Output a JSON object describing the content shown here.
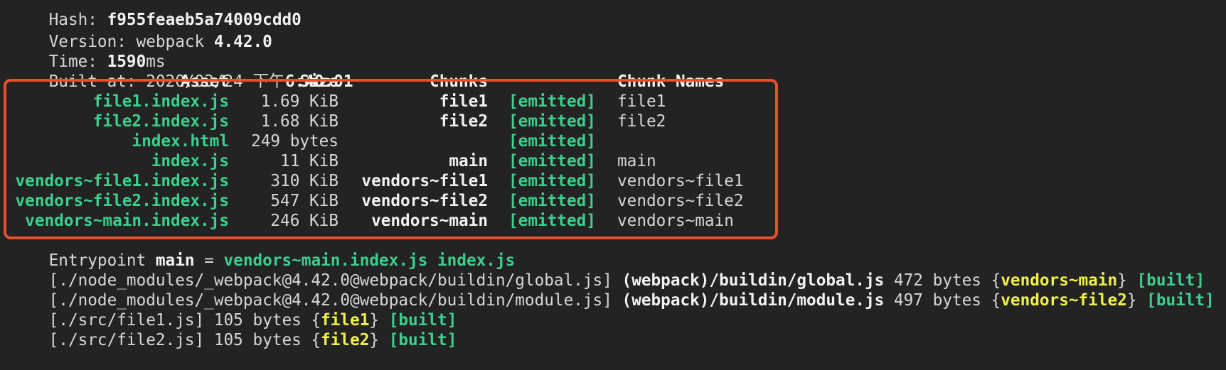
{
  "header": {
    "hash_label": "Hash: ",
    "hash_value": "f955feaeb5a74009cdd0",
    "version_label": "Version: webpack ",
    "version_value": "4.42.0",
    "time_label": "Time: ",
    "time_value": "1590",
    "time_unit": "ms",
    "built_label": "Built at: 2020/03/24 下午",
    "built_value": "6:40:01"
  },
  "assets_table": {
    "headers": {
      "asset": "Asset",
      "size": "Size",
      "chunks": "Chunks",
      "chunk_names": "Chunk Names"
    },
    "rows": [
      {
        "asset": "file1.index.js",
        "size": "1.69 KiB",
        "chunks": "file1",
        "status": "[emitted]",
        "chunk_names": "file1"
      },
      {
        "asset": "file2.index.js",
        "size": "1.68 KiB",
        "chunks": "file2",
        "status": "[emitted]",
        "chunk_names": "file2"
      },
      {
        "asset": "index.html",
        "size": "249 bytes",
        "chunks": "",
        "status": "[emitted]",
        "chunk_names": ""
      },
      {
        "asset": "index.js",
        "size": "11 KiB",
        "chunks": "main",
        "status": "[emitted]",
        "chunk_names": "main"
      },
      {
        "asset": "vendors~file1.index.js",
        "size": "310 KiB",
        "chunks": "vendors~file1",
        "status": "[emitted]",
        "chunk_names": "vendors~file1"
      },
      {
        "asset": "vendors~file2.index.js",
        "size": "547 KiB",
        "chunks": "vendors~file2",
        "status": "[emitted]",
        "chunk_names": "vendors~file2"
      },
      {
        "asset": "vendors~main.index.js",
        "size": "246 KiB",
        "chunks": "vendors~main",
        "status": "[emitted]",
        "chunk_names": "vendors~main"
      }
    ]
  },
  "entrypoint": {
    "label": "Entrypoint ",
    "name": "main",
    "equals": " = ",
    "files": "vendors~main.index.js index.js"
  },
  "modules": [
    {
      "path": "[./node_modules/_webpack@4.42.0@webpack/buildin/global.js] ",
      "name": "(webpack)/buildin/global.js",
      "size": " 472 bytes {",
      "chunk": "vendors~main",
      "close": "} ",
      "status": "[built]"
    },
    {
      "path": "[./node_modules/_webpack@4.42.0@webpack/buildin/module.js] ",
      "name": "(webpack)/buildin/module.js",
      "size": " 497 bytes {",
      "chunk": "vendors~file2",
      "close": "} ",
      "status": "[built]"
    },
    {
      "path": "[./src/file1.js] ",
      "name": "",
      "size": "105 bytes {",
      "chunk": "file1",
      "close": "} ",
      "status": "[built]"
    },
    {
      "path": "[./src/file2.js] ",
      "name": "",
      "size": "105 bytes {",
      "chunk": "file2",
      "close": "} ",
      "status": "[built]"
    }
  ],
  "colors": {
    "background": "#232323",
    "text": "#d7d7d7",
    "green": "#3ccf8e",
    "yellow": "#f0f04a",
    "annotation_box": "#ea4f2d"
  }
}
